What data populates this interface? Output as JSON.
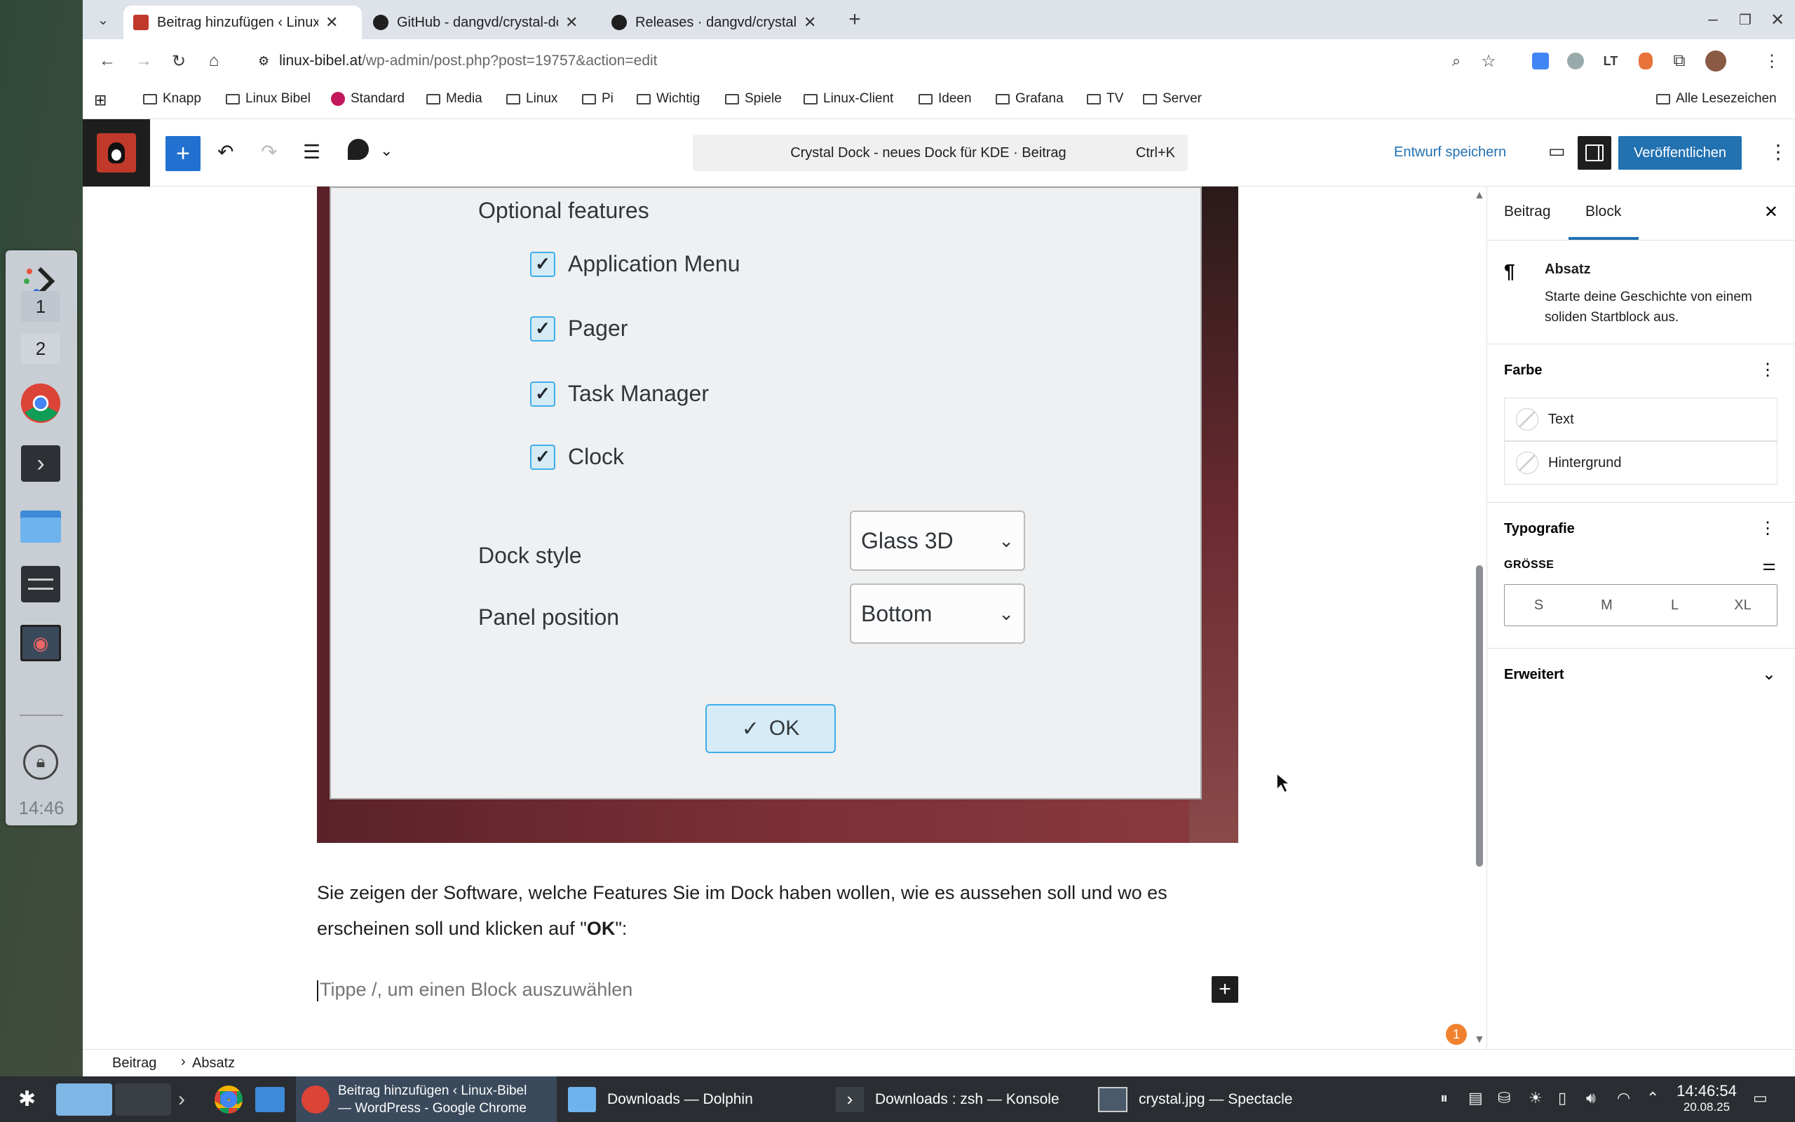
{
  "browser": {
    "tabs": [
      {
        "title": "Beitrag hinzufügen ‹ Linux-",
        "active": true
      },
      {
        "title": "GitHub - dangvd/crystal-do",
        "active": false
      },
      {
        "title": "Releases · dangvd/crystal-d",
        "active": false
      }
    ],
    "url_host": "linux-bibel.at",
    "url_path": "/wp-admin/post.php?post=19757&action=edit",
    "bookmarks": [
      "Knapp",
      "Linux Bibel",
      "Standard",
      "Media",
      "Linux",
      "Pi",
      "Wichtig",
      "Spiele",
      "Linux-Client",
      "Ideen",
      "Grafana",
      "TV",
      "Server"
    ],
    "all_bookmarks": "Alle Lesezeichen"
  },
  "editor": {
    "command_title": "Crystal Dock - neues Dock für KDE · Beitrag",
    "command_shortcut": "Ctrl+K",
    "save_draft": "Entwurf speichern",
    "publish": "Veröffentlichen"
  },
  "dialog": {
    "heading": "Optional features",
    "checkboxes": [
      "Application Menu",
      "Pager",
      "Task Manager",
      "Clock"
    ],
    "dock_style_label": "Dock style",
    "dock_style_value": "Glass 3D",
    "panel_position_label": "Panel position",
    "panel_position_value": "Bottom",
    "ok": "OK"
  },
  "content": {
    "paragraph_before": "Sie zeigen der Software, welche Features Sie im Dock haben wollen, wie es aussehen soll und wo es erscheinen soll und klicken auf \"",
    "paragraph_bold": "OK",
    "paragraph_after": "\":",
    "placeholder": "Tippe /, um einen Block auszuwählen",
    "notification_count": "1"
  },
  "sidebar": {
    "tab_post": "Beitrag",
    "tab_block": "Block",
    "block_name": "Absatz",
    "block_desc": "Starte deine Geschichte von einem soliden Startblock aus.",
    "color_heading": "Farbe",
    "color_text": "Text",
    "color_bg": "Hintergrund",
    "typo_heading": "Typografie",
    "size_label": "GRÖSSE",
    "sizes": [
      "S",
      "M",
      "L",
      "XL"
    ],
    "advanced": "Erweitert"
  },
  "breadcrumb": [
    "Beitrag",
    "Absatz"
  ],
  "kde_dock": {
    "desktops": [
      "1",
      "2"
    ],
    "time": "14:46"
  },
  "taskbar": {
    "windows": [
      "Beitrag hinzufügen ‹ Linux-Bibel — WordPress - Google Chrome",
      "Downloads — Dolphin",
      "Downloads : zsh — Konsole",
      "crystal.jpg — Spectacle"
    ],
    "clock_time": "14:46:54",
    "clock_date": "20.08.25"
  }
}
